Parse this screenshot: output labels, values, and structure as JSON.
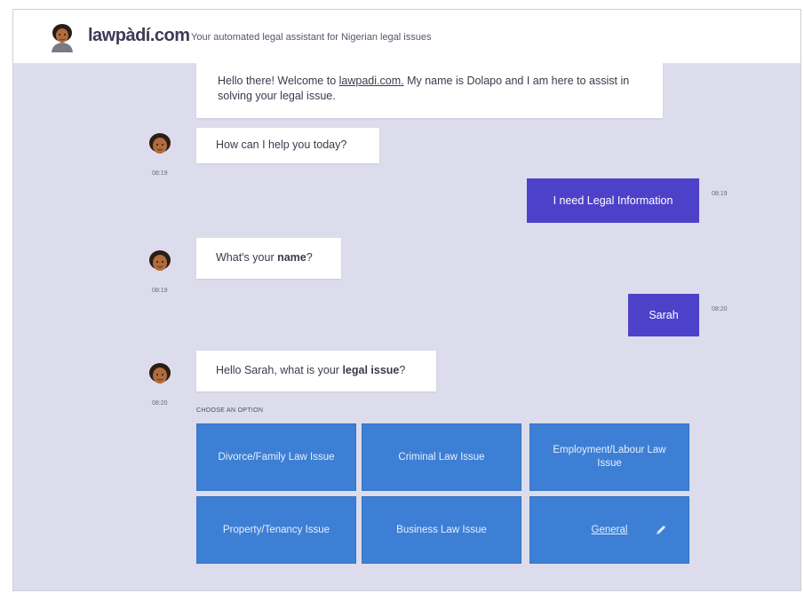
{
  "header": {
    "brand": "lawpàdí.com",
    "tagline": "Your automated legal assistant for Nigerian legal issues"
  },
  "messages": {
    "welcome_pre": "Hello there! Welcome to ",
    "welcome_link": "lawpadi.com.",
    "welcome_post": " My name is Dolapo and I am here to assist in solving your legal issue.",
    "help": "How can I help you today?",
    "help_time": "08:19",
    "user_info": "I need Legal Information",
    "user_info_time": "08:19",
    "name_pre": "What's your ",
    "name_bold": "name",
    "name_post": "?",
    "name_time": "08:19",
    "user_name": "Sarah",
    "user_name_time": "08:20",
    "issue_pre": "Hello Sarah, what is your ",
    "issue_bold": "legal issue",
    "issue_post": "?",
    "issue_time": "08:20"
  },
  "choose_label": "CHOOSE AN OPTION",
  "options": [
    {
      "label": "Divorce/Family Law Issue"
    },
    {
      "label": "Criminal Law Issue"
    },
    {
      "label": "Employment/Labour Law Issue"
    },
    {
      "label": "Property/Tenancy Issue"
    },
    {
      "label": "Business Law Issue"
    },
    {
      "label": "General",
      "icon": "pencil-icon"
    }
  ],
  "colors": {
    "background": "#dcdcec",
    "user_bubble": "#4e41c9",
    "option_button": "#3d7fd4"
  }
}
